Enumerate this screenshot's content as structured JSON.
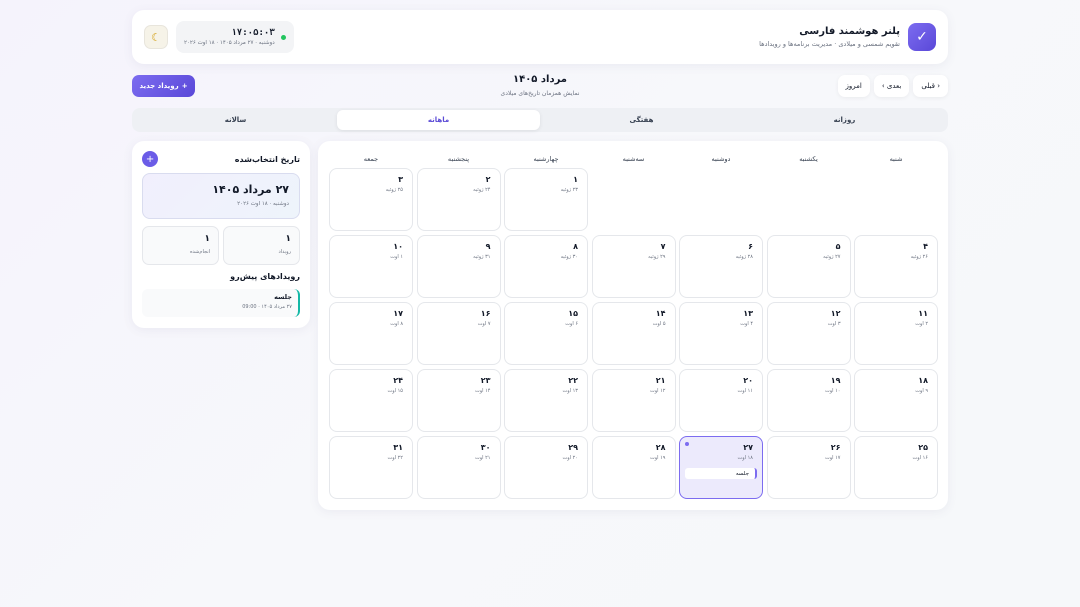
{
  "app": {
    "title": "پلنر هوشمند فارسی",
    "subtitle": "تقویم شمسی و میلادی · مدیریت برنامه‌ها و رویدادها"
  },
  "clock": {
    "time": "۱۷:۰۵:۰۳",
    "date": "دوشنبه · ۲۷ مرداد ۱۴۰۵ · ۱۸ اوت ۲۰۲۶"
  },
  "icons": {
    "logo": "check-icon",
    "theme": "moon-icon",
    "add": "plus-icon",
    "status": "online-dot"
  },
  "colors": {
    "accent": "#6b5ce7",
    "success": "#22c55e",
    "teal": "#14b8a6"
  },
  "toolbar": {
    "prev": "‹ قبلی",
    "next": "بعدی ›",
    "today": "امروز",
    "month_title": "مرداد ۱۴۰۵",
    "month_sub": "نمایش همزمان تاریخ‌های میلادی",
    "new_event": "رویداد جدید"
  },
  "tabs": [
    "روزانه",
    "هفتگی",
    "ماهانه",
    "سالانه"
  ],
  "active_tab": "ماهانه",
  "weekdays": [
    "شنبه",
    "یکشنبه",
    "دوشنبه",
    "سه‌شنبه",
    "چهارشنبه",
    "پنجشنبه",
    "جمعه"
  ],
  "days": [
    {
      "d": "۱",
      "g": "۲۳ ژوئیه"
    },
    {
      "d": "۲",
      "g": "۲۴ ژوئیه"
    },
    {
      "d": "۳",
      "g": "۲۵ ژوئیه"
    },
    {
      "d": "۴",
      "g": "۲۶ ژوئیه"
    },
    {
      "d": "۵",
      "g": "۲۷ ژوئیه"
    },
    {
      "d": "۶",
      "g": "۲۸ ژوئیه"
    },
    {
      "d": "۷",
      "g": "۲۹ ژوئیه"
    },
    {
      "d": "۸",
      "g": "۳۰ ژوئیه"
    },
    {
      "d": "۹",
      "g": "۳۱ ژوئیه"
    },
    {
      "d": "۱۰",
      "g": "۱ اوت"
    },
    {
      "d": "۱۱",
      "g": "۲ اوت"
    },
    {
      "d": "۱۲",
      "g": "۳ اوت"
    },
    {
      "d": "۱۳",
      "g": "۴ اوت"
    },
    {
      "d": "۱۴",
      "g": "۵ اوت"
    },
    {
      "d": "۱۵",
      "g": "۶ اوت"
    },
    {
      "d": "۱۶",
      "g": "۷ اوت"
    },
    {
      "d": "۱۷",
      "g": "۸ اوت"
    },
    {
      "d": "۱۸",
      "g": "۹ اوت"
    },
    {
      "d": "۱۹",
      "g": "۱۰ اوت"
    },
    {
      "d": "۲۰",
      "g": "۱۱ اوت"
    },
    {
      "d": "۲۱",
      "g": "۱۲ اوت"
    },
    {
      "d": "۲۲",
      "g": "۱۳ اوت"
    },
    {
      "d": "۲۳",
      "g": "۱۴ اوت"
    },
    {
      "d": "۲۴",
      "g": "۱۵ اوت"
    },
    {
      "d": "۲۵",
      "g": "۱۶ اوت"
    },
    {
      "d": "۲۶",
      "g": "۱۷ اوت"
    },
    {
      "d": "۲۷",
      "g": "۱۸ اوت",
      "selected": true,
      "event": "جلسه"
    },
    {
      "d": "۲۸",
      "g": "۱۹ اوت"
    },
    {
      "d": "۲۹",
      "g": "۲۰ اوت"
    },
    {
      "d": "۳۰",
      "g": "۲۱ اوت"
    },
    {
      "d": "۳۱",
      "g": "۲۲ اوت"
    }
  ],
  "first_day_column": 4,
  "sidebar": {
    "title": "تاریخ انتخاب‌شده",
    "selected_date": "۲۷ مرداد ۱۴۰۵",
    "selected_sub": "دوشنبه · ۱۸ اوت ۲۰۲۶",
    "stats": [
      {
        "num": "۱",
        "label": "رویداد"
      },
      {
        "num": "۱",
        "label": "انجام‌شده"
      }
    ],
    "upcoming_title": "رویدادهای پیش‌رو",
    "upcoming": [
      {
        "name": "جلسه",
        "time": "۲۷ مرداد ۱۴۰۵ · 09:00"
      }
    ]
  }
}
